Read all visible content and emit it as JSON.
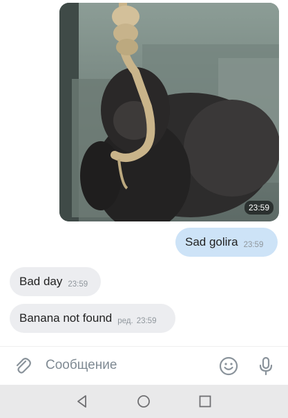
{
  "messages": {
    "photo": {
      "time": "23:59"
    },
    "outgoing": [
      {
        "text": "Sad golira",
        "time": "23:59"
      }
    ],
    "incoming": [
      {
        "text": "Bad day",
        "time": "23:59"
      },
      {
        "text": "Banana not found",
        "edited_label": "ред.",
        "time": "23:59"
      }
    ]
  },
  "composer": {
    "placeholder": "Сообщение",
    "attach_icon": "paperclip-icon",
    "emoji_icon": "smiley-icon",
    "voice_icon": "microphone-icon"
  },
  "navbar": {
    "back_icon": "triangle-back-icon",
    "home_icon": "circle-home-icon",
    "recents_icon": "square-recents-icon"
  },
  "colors": {
    "outgoing_bubble": "#cde3f7",
    "incoming_bubble": "#ecedf0",
    "icon_gray": "#8a939b",
    "navbar_bg": "#e9e9ea"
  }
}
